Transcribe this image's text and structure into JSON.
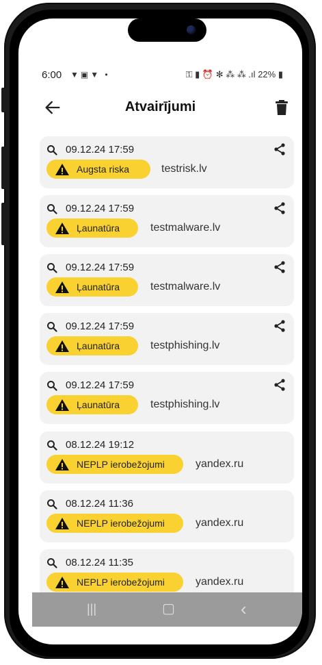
{
  "status_bar": {
    "time": "6:00",
    "left_icons": "▼▣▼ •",
    "right_icons": "⚿ ▮ ⏰ ✻ ⁂ ⁂ .ıl",
    "battery": "22%"
  },
  "app_bar": {
    "title": "Atvairījumi"
  },
  "history": [
    {
      "date": "09.12.24 17:59",
      "badge": "Augsta riska",
      "domain": "testrisk.lv",
      "shareable": true
    },
    {
      "date": "09.12.24 17:59",
      "badge": "Ļaunatūra",
      "domain": "testmalware.lv",
      "shareable": true
    },
    {
      "date": "09.12.24 17:59",
      "badge": "Ļaunatūra",
      "domain": "testmalware.lv",
      "shareable": true
    },
    {
      "date": "09.12.24 17:59",
      "badge": "Ļaunatūra",
      "domain": "testphishing.lv",
      "shareable": true
    },
    {
      "date": "09.12.24 17:59",
      "badge": "Ļaunatūra",
      "domain": "testphishing.lv",
      "shareable": true
    },
    {
      "date": "08.12.24 19:12",
      "badge": "NEPLP ierobežojumi",
      "domain": "yandex.ru",
      "shareable": false
    },
    {
      "date": "08.12.24 11:36",
      "badge": "NEPLP ierobežojumi",
      "domain": "yandex.ru",
      "shareable": false
    },
    {
      "date": "08.12.24 11:35",
      "badge": "NEPLP ierobežojumi",
      "domain": "yandex.ru",
      "shareable": false
    }
  ],
  "nav_bar": {
    "recents": "|||",
    "home": "▢",
    "back": "‹"
  },
  "colors": {
    "badge": "#f9d232",
    "card": "#f3f2f2",
    "nav": "#9b9b9b"
  }
}
